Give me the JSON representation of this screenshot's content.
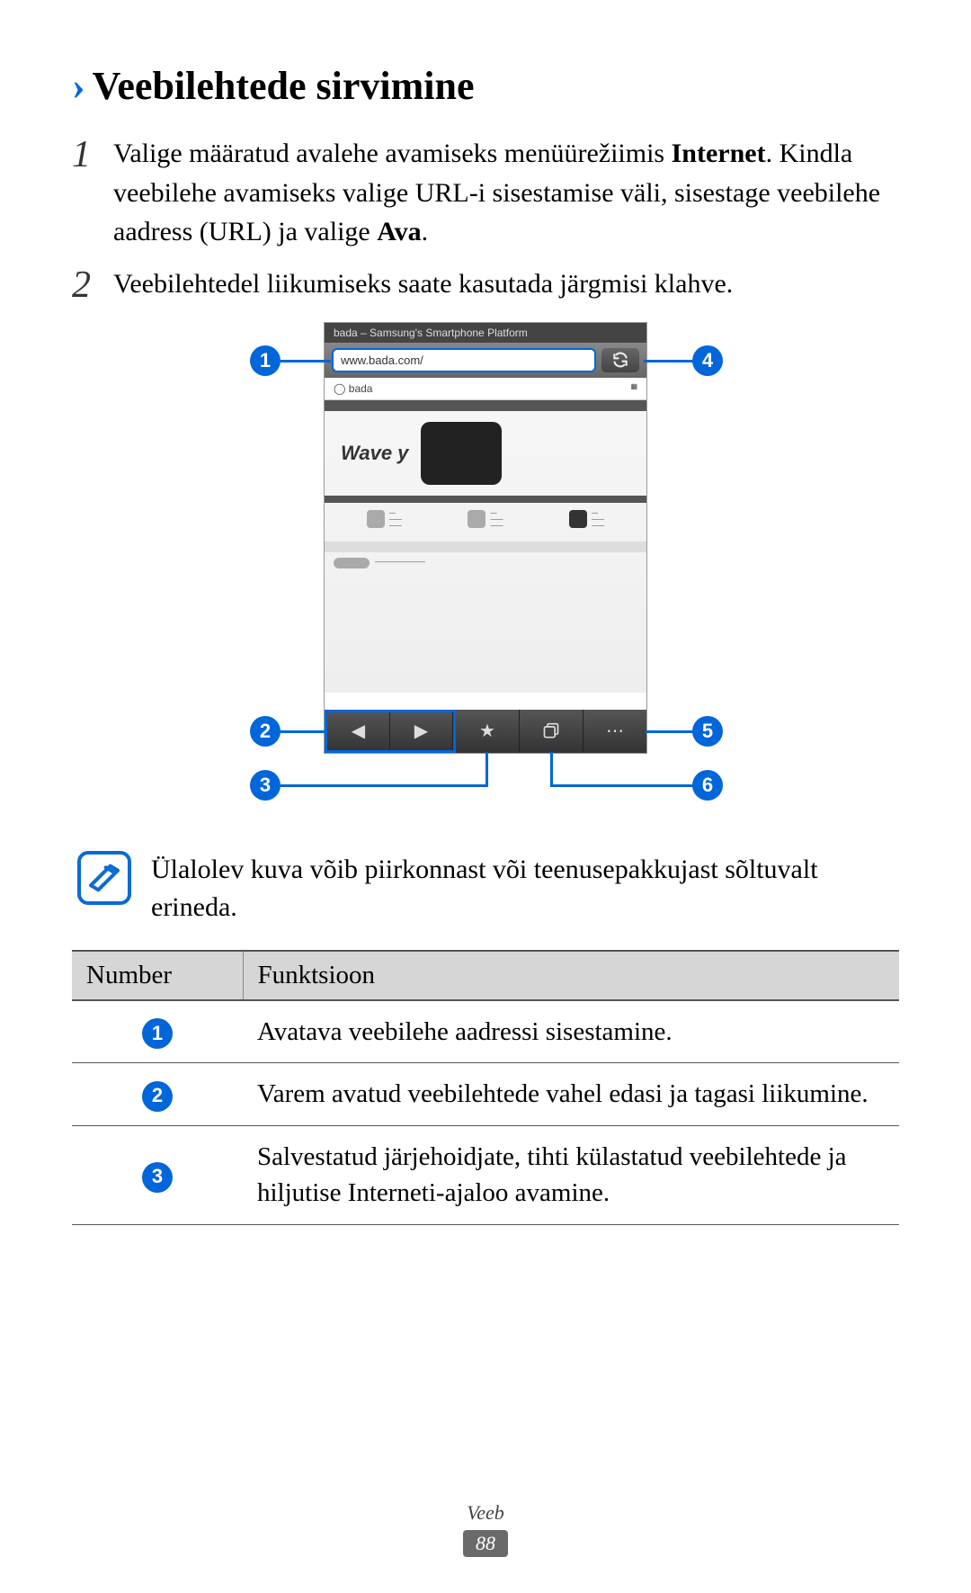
{
  "heading": "Veebilehtede sirvimine",
  "steps": [
    {
      "num": "1",
      "text_a": "Valige määratud avalehe avamiseks menüürežiimis ",
      "text_bold1": "Internet",
      "text_b": ". Kindla veebilehe avamiseks valige URL-i sisestamise väli, sisestage veebilehe aadress (URL) ja valige ",
      "text_bold2": "Ava",
      "text_c": "."
    },
    {
      "num": "2",
      "text_a": "Veebilehtedel liikumiseks saate kasutada järgmisi klahve."
    }
  ],
  "screenshot": {
    "title": "bada – Samsung's Smartphone Platform",
    "url": "www.bada.com/",
    "brand": "bada",
    "wave": "Wave y",
    "callouts": {
      "c1": "1",
      "c2": "2",
      "c3": "3",
      "c4": "4",
      "c5": "5",
      "c6": "6"
    }
  },
  "note": "Ülalolev kuva võib piirkonnast või teenusepakkujast sõltuvalt erineda.",
  "table": {
    "headers": [
      "Number",
      "Funktsioon"
    ],
    "rows": [
      {
        "n": "1",
        "text": "Avatava veebilehe aadressi sisestamine."
      },
      {
        "n": "2",
        "text": "Varem avatud veebilehtede vahel edasi ja tagasi liikumine."
      },
      {
        "n": "3",
        "text": "Salvestatud järjehoidjate, tihti külastatud veebilehtede ja hiljutise Interneti-ajaloo avamine."
      }
    ]
  },
  "footer": {
    "category": "Veeb",
    "page": "88"
  }
}
